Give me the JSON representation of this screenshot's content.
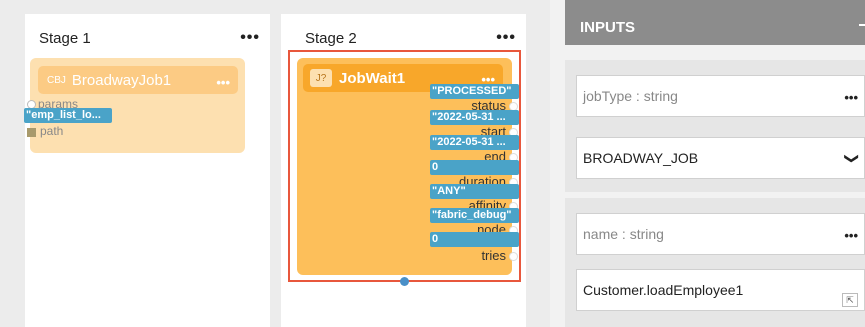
{
  "stage1": {
    "title": "Stage 1",
    "menu": "•••",
    "node": {
      "tag": "CBJ",
      "name": "BroadwayJob1",
      "menu": "•••",
      "inputs": [
        {
          "label": "params",
          "value": "\"emp_list_lo..."
        },
        {
          "label": "path",
          "value": ""
        }
      ]
    }
  },
  "stage2": {
    "title": "Stage 2",
    "menu": "•••",
    "node": {
      "tag": "J?",
      "name": "JobWait1",
      "menu": "•••",
      "outputs": [
        {
          "label": "status",
          "value": "\"PROCESSED\""
        },
        {
          "label": "start",
          "value": "\"2022-05-31 ..."
        },
        {
          "label": "end",
          "value": "\"2022-05-31 ..."
        },
        {
          "label": "duration",
          "value": "0"
        },
        {
          "label": "affinity",
          "value": "\"ANY\""
        },
        {
          "label": "node",
          "value": "\"fabric_debug\""
        },
        {
          "label": "tries",
          "value": "0"
        }
      ]
    }
  },
  "inputs_panel": {
    "title": "INPUTS",
    "params": [
      {
        "label": "jobType : string",
        "menu": "•••",
        "value": "BROADWAY_JOB",
        "chevron": "❯"
      },
      {
        "label": "name : string",
        "menu": "•••",
        "value": "Customer.loadEmployee1",
        "corner": "⇱"
      }
    ]
  }
}
